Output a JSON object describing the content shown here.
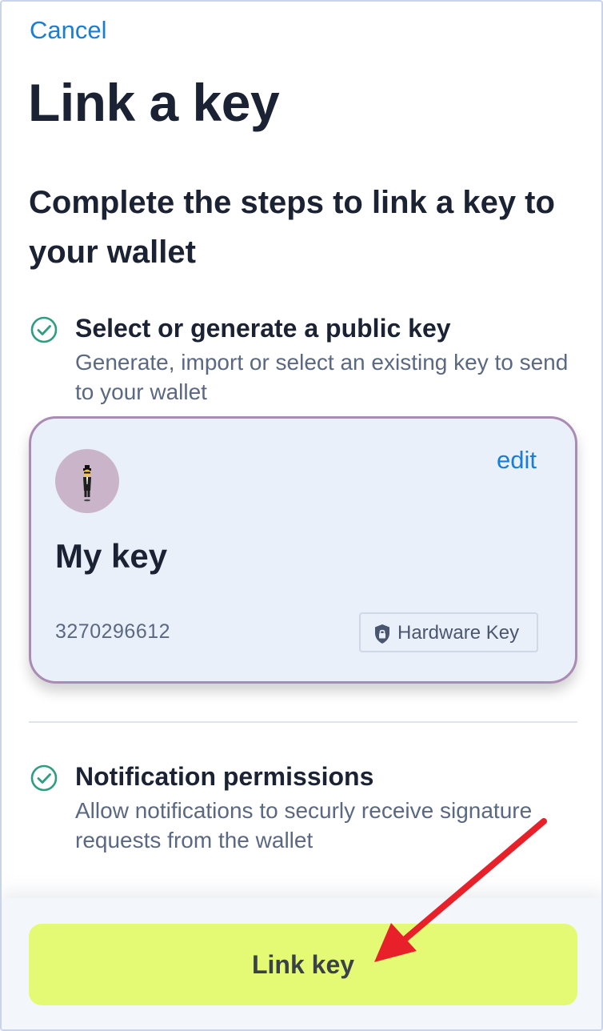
{
  "header": {
    "cancel_label": "Cancel",
    "title": "Link a key"
  },
  "subtitle": "Complete the steps to link a key to your wallet",
  "steps": [
    {
      "title": "Select or generate a public key",
      "description": "Generate, import or select an existing key to send to your wallet",
      "status_icon": "check-circle-icon"
    },
    {
      "title": "Notification permissions",
      "description": "Allow notifications to securly receive signature requests from the wallet",
      "status_icon": "check-circle-icon"
    }
  ],
  "key_card": {
    "avatar_icon": "person-in-suit-levitating-emoji",
    "edit_label": "edit",
    "name": "My key",
    "key_id": "3270296612",
    "badge_icon": "shield-lock-icon",
    "badge_label": "Hardware Key"
  },
  "footer": {
    "link_button_label": "Link key"
  },
  "colors": {
    "accent": "#1a7ed4",
    "check": "#2e9e82",
    "button": "#e5fa74",
    "card_border": "#a98bb4",
    "arrow": "#e8202a"
  }
}
